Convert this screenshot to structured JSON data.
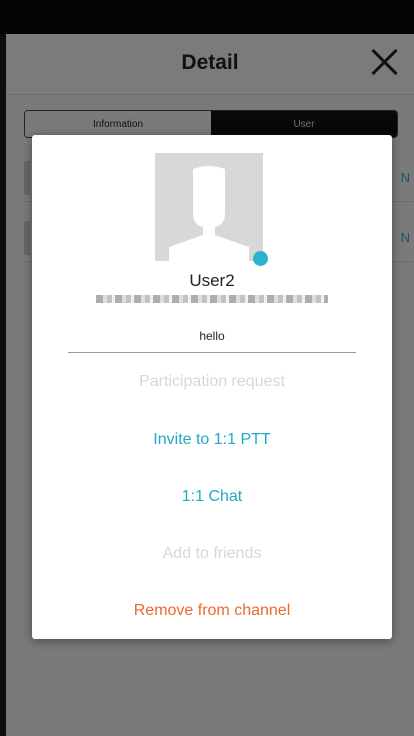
{
  "header": {
    "title": "Detail"
  },
  "tabs": [
    {
      "label": "Information"
    },
    {
      "label": "User"
    }
  ],
  "background_rows": [
    {
      "trailing": "N"
    },
    {
      "trailing": "N"
    }
  ],
  "dialog": {
    "username": "User2",
    "status_message": "hello",
    "actions": [
      {
        "label": "Participation request"
      },
      {
        "label": "Invite to 1:1 PTT"
      },
      {
        "label": "1:1 Chat"
      },
      {
        "label": "Add to friends"
      },
      {
        "label": "Remove from channel"
      }
    ]
  },
  "colors": {
    "accent": "#22a9c4",
    "danger": "#f0682e",
    "disabled": "#d7d7d7",
    "presence": "#29b3cc"
  }
}
